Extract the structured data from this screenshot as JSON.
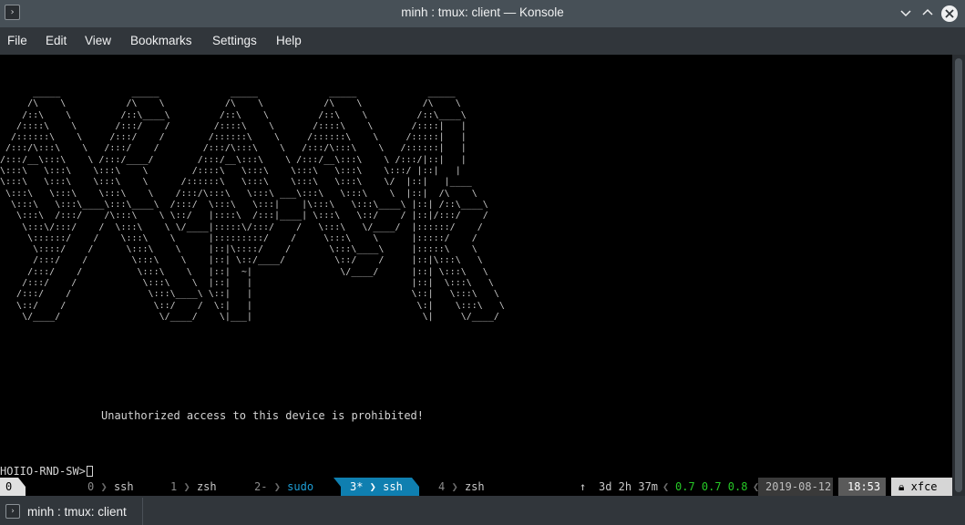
{
  "window": {
    "title": "minh : tmux: client — Konsole",
    "app_icon": "terminal-icon"
  },
  "menubar": {
    "items": [
      "File",
      "Edit",
      "View",
      "Bookmarks",
      "Settings",
      "Help"
    ]
  },
  "terminal": {
    "ascii_art": "      _____             _____             _____             _____             _____\n     /\\    \\           /\\    \\           /\\    \\           /\\    \\           /\\    \\\n    /::\\    \\         /::\\____\\         /::\\    \\         /::\\    \\         /::\\____\\\n   /::::\\    \\       /:::/    /        /::::\\    \\       /::::\\    \\       /::::|   |\n  /::::::\\    \\     /:::/    /        /::::::\\    \\     /::::::\\    \\     /:::::|   |\n /:::/\\:::\\    \\   /:::/    /        /:::/\\:::\\    \\   /:::/\\:::\\    \\   /::::::|   |\n/:::/__\\:::\\    \\ /:::/____/        /:::/__\\:::\\    \\ /:::/__\\:::\\    \\ /:::/|::|   |\n\\:::\\   \\:::\\    \\:::\\    \\        /::::\\   \\:::\\    \\:::\\   \\:::\\    \\:::/ |::|   |\n\\:::\\   \\:::\\    \\:::\\    \\      /::::::\\   \\:::\\    \\:::\\   \\:::\\    \\/  |::|   |____\n \\:::\\   \\:::\\    \\:::\\    \\    /:::/\\:::\\   \\:::\\ ___\\:::\\   \\:::\\    \\  |::|  /\\    \\\n  \\:::\\   \\:::\\____\\:::\\____\\  /:::/  \\:::\\   \\:::|    |\\:::\\   \\:::\\____\\ |::| /::\\____\\\n   \\:::\\  /:::/    /\\:::\\    \\ \\::/   |::::\\  /:::|____| \\:::\\   \\::/    / |::|/:::/    /\n    \\:::\\/:::/    /  \\:::\\    \\ \\/____|:::::\\/:::/    /   \\:::\\   \\/____/  |::::::/    /\n     \\::::::/    /    \\:::\\    \\      |:::::::::/    /     \\:::\\    \\      |:::::/    /\n      \\::::/    /      \\:::\\    \\     |::|\\::::/    /       \\:::\\____\\     |:::::\\    \\\n      /:::/    /        \\:::\\    \\    |::| \\::/____/         \\::/    /     |::|\\:::\\   \\\n     /:::/    /          \\:::\\    \\   |::|  ~|                \\/____/      |::| \\:::\\   \\\n    /:::/    /            \\:::\\    \\  |::|   |                             |::|  \\:::\\   \\\n   /:::/    /              \\:::\\____\\ \\::|   |                             \\::|   \\:::\\   \\\n   \\::/    /                \\::/    /  \\:|   |                              \\:|    \\:::\\   \\\n    \\/____/                  \\/____/    \\|___|                               \\|     \\/____/",
    "banner": "Unauthorized access to this device is prohibited!",
    "prompt": "HOIIO-RND-SW>"
  },
  "tmux": {
    "session": "0",
    "windows": [
      {
        "index": "0",
        "name": "ssh",
        "active": false
      },
      {
        "index": "1",
        "name": "zsh",
        "active": false
      },
      {
        "index": "2-",
        "name": "sudo",
        "active": false
      },
      {
        "index": "3*",
        "name": "ssh",
        "active": true
      },
      {
        "index": "4",
        "name": "zsh",
        "active": false
      }
    ],
    "uptime_arrow": "↑",
    "uptime": "3d 2h 37m",
    "load": "0.7 0.7 0.8",
    "date": "2019-08-12",
    "time": "18:53",
    "lock_icon": "lock-icon",
    "host": "xfce"
  },
  "tabs": [
    {
      "label": "minh : tmux: client"
    }
  ]
}
